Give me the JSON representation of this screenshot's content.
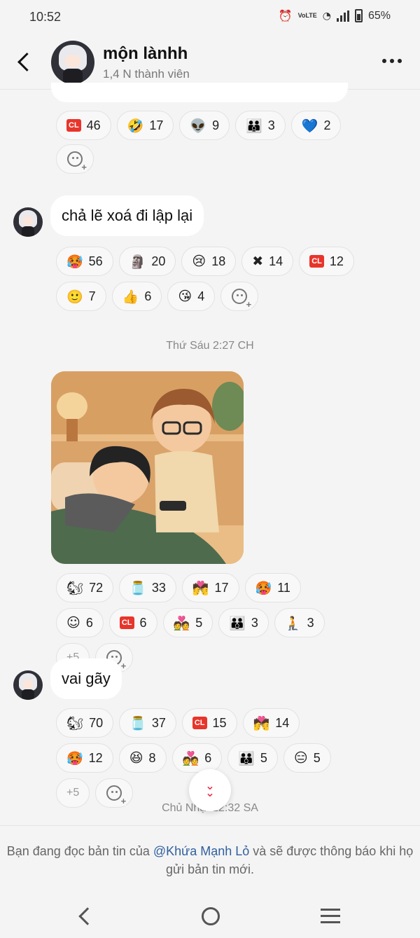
{
  "status": {
    "time": "10:52",
    "battery": "65%",
    "network": "VoLTE"
  },
  "header": {
    "title": "mộn lànhh",
    "subtitle": "1,4 N thành viên"
  },
  "reactions_top": [
    {
      "emoji": "CL",
      "count": "46"
    },
    {
      "emoji": "🤣",
      "count": "17"
    },
    {
      "emoji": "👽",
      "count": "9"
    },
    {
      "emoji": "👪",
      "count": "3"
    },
    {
      "emoji": "💙",
      "count": "2"
    }
  ],
  "message1": {
    "text": "chả lẽ xoá đi lập lại"
  },
  "reactions_1": [
    {
      "emoji": "🥵",
      "count": "56"
    },
    {
      "emoji": "🗿",
      "count": "20"
    },
    {
      "emoji": "😢",
      "count": "18"
    },
    {
      "emoji": "✖",
      "count": "14"
    },
    {
      "emoji": "CL",
      "count": "12"
    },
    {
      "emoji": "🙂",
      "count": "7"
    },
    {
      "emoji": "👍",
      "count": "6"
    },
    {
      "emoji": "😘",
      "count": "4"
    }
  ],
  "date1": "Thứ Sáu 2:27 CH",
  "reactions_2": [
    {
      "emoji": "🐿",
      "count": "72"
    },
    {
      "emoji": "🫙",
      "count": "33"
    },
    {
      "emoji": "💏",
      "count": "17"
    },
    {
      "emoji": "🥵",
      "count": "11"
    },
    {
      "emoji": "☺",
      "count": "6"
    },
    {
      "emoji": "CL",
      "count": "6"
    },
    {
      "emoji": "💑",
      "count": "5"
    },
    {
      "emoji": "👪",
      "count": "3"
    },
    {
      "emoji": "🧎",
      "count": "3"
    }
  ],
  "reactions_2_more": "+5",
  "message2": {
    "text": "vai gãy"
  },
  "reactions_3": [
    {
      "emoji": "🐿",
      "count": "70"
    },
    {
      "emoji": "🫙",
      "count": "37"
    },
    {
      "emoji": "CL",
      "count": "15"
    },
    {
      "emoji": "💏",
      "count": "14"
    },
    {
      "emoji": "🥵",
      "count": "12"
    },
    {
      "emoji": "😆",
      "count": "8"
    },
    {
      "emoji": "💑",
      "count": "6"
    },
    {
      "emoji": "👪",
      "count": "5"
    },
    {
      "emoji": "😑",
      "count": "5"
    }
  ],
  "reactions_3_more": "+5",
  "date2": "Chủ Nhật 12:32 SA",
  "footer": {
    "prefix": "Bạn đang đọc bản tin của ",
    "mention": "@Khứa Mạnh Lỏ",
    "suffix": " và sẽ được thông báo khi họ gửi bản tin mới."
  }
}
